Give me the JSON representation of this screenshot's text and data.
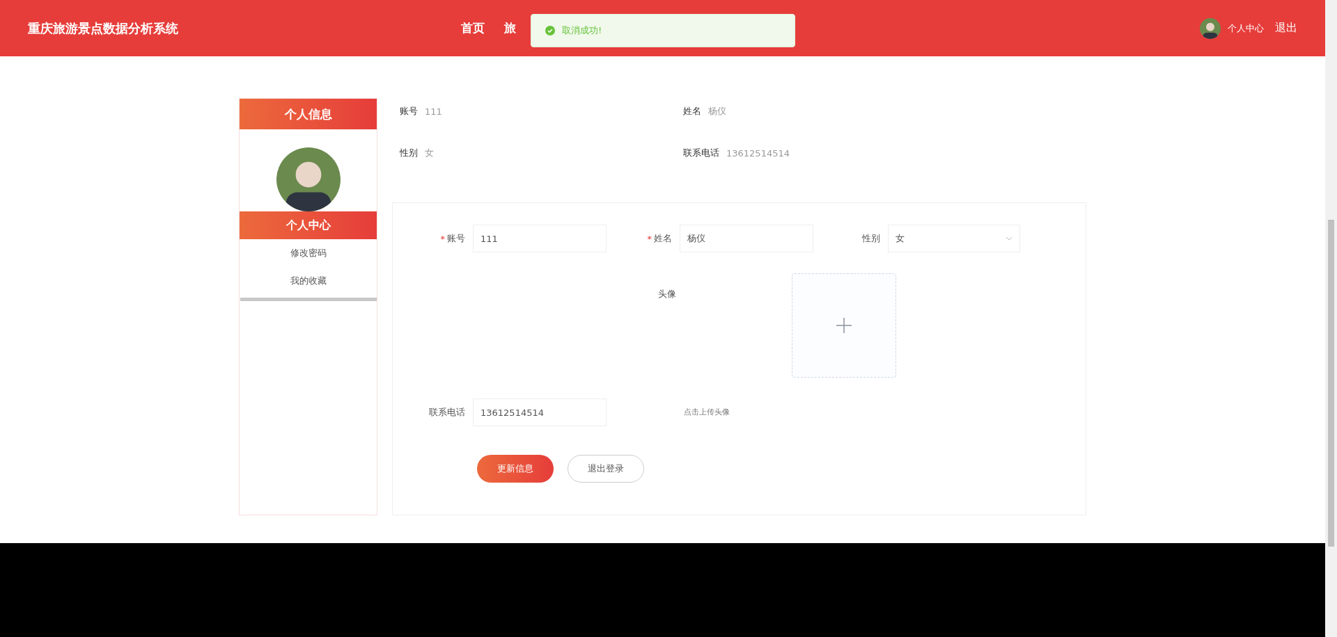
{
  "header": {
    "title": "重庆旅游景点数据分析系统",
    "nav": [
      {
        "label": "首页"
      },
      {
        "label": "旅"
      }
    ],
    "user_menu": {
      "profile": "个人中心",
      "logout": "退出"
    }
  },
  "toast": {
    "kind": "success",
    "message": "取消成功!"
  },
  "sidebar": {
    "title": "个人信息",
    "items": [
      {
        "label": "个人中心",
        "selected": true
      },
      {
        "label": "修改密码",
        "selected": false
      },
      {
        "label": "我的收藏",
        "selected": false
      }
    ]
  },
  "info": [
    {
      "label": "账号",
      "value": "111"
    },
    {
      "label": "姓名",
      "value": "杨仪"
    },
    {
      "label": "性别",
      "value": "女"
    },
    {
      "label": "联系电话",
      "value": "13612514514"
    }
  ],
  "form": {
    "account": {
      "label": "账号",
      "required_mark": "*",
      "value": "111"
    },
    "name": {
      "label": "姓名",
      "required_mark": "*",
      "value": "杨仪"
    },
    "gender": {
      "label": "性别",
      "value": "女"
    },
    "avatar": {
      "label": "头像",
      "hint": "点击上传头像"
    },
    "phone": {
      "label": "联系电话",
      "value": "13612514514"
    },
    "buttons": [
      {
        "kind": "primary",
        "label": "更新信息"
      },
      {
        "kind": "default",
        "label": "退出登录"
      }
    ]
  }
}
